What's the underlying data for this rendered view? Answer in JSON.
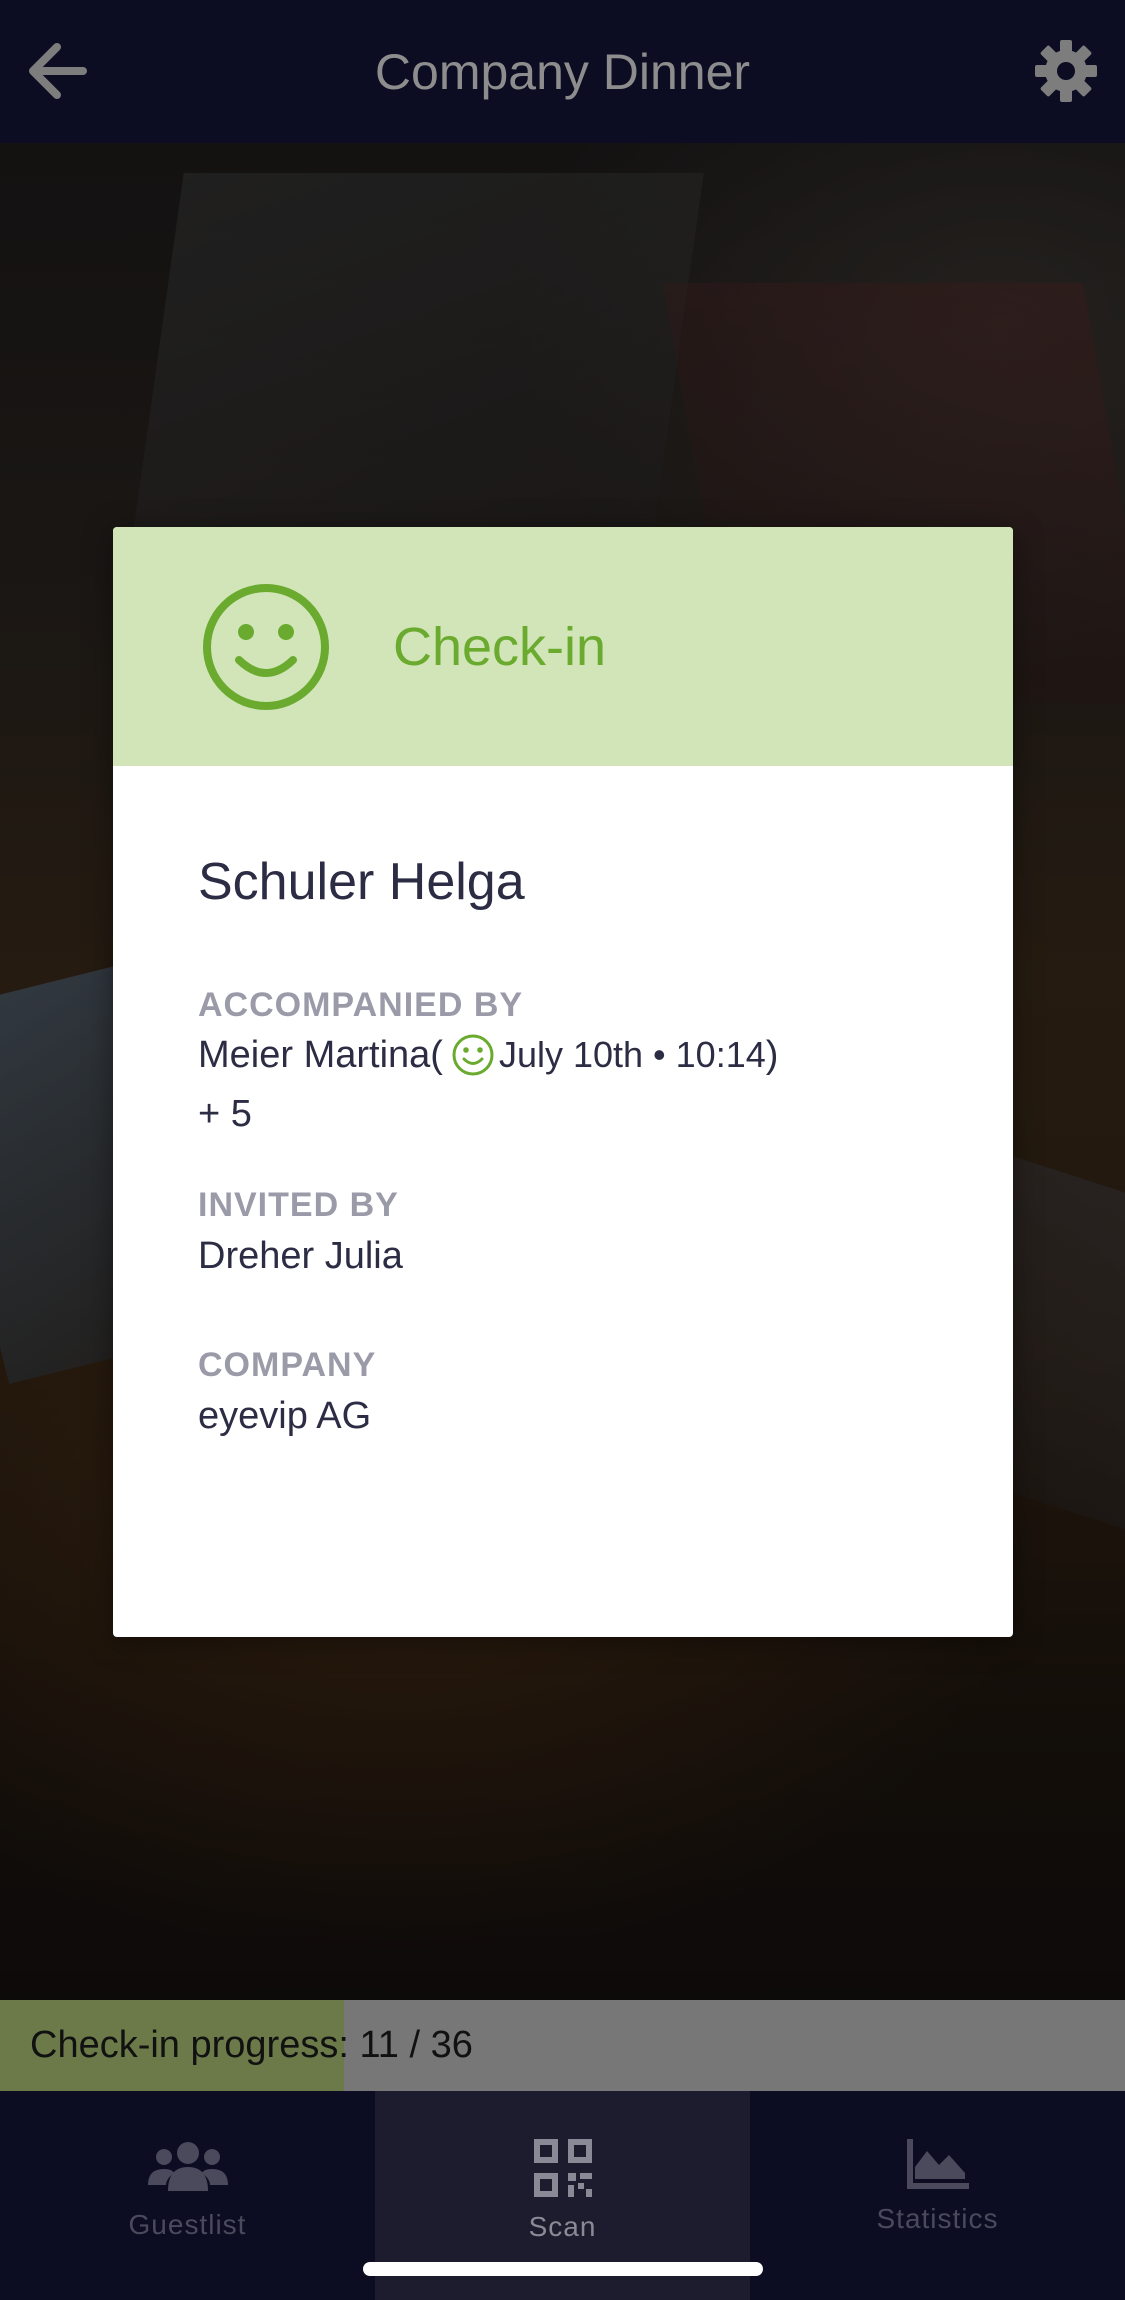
{
  "header": {
    "title": "Company Dinner",
    "back_icon": "arrow-left-icon",
    "settings_icon": "gear-icon"
  },
  "modal": {
    "status": "Check-in",
    "status_icon": "smiley-icon",
    "status_color": "#6aaa2e",
    "header_bg": "#d1e5b8",
    "guest_name": "Schuler Helga",
    "accompanied_label": "ACCOMPANIED BY",
    "companion_name": "Meier Martina",
    "companion_open": "(",
    "companion_checkin_time": "July 10th • 10:14",
    "companion_close": ")",
    "additional_guests": "+ 5",
    "invited_label": "INVITED BY",
    "invited_by": "Dreher Julia",
    "company_label": "COMPANY",
    "company": "eyevip AG"
  },
  "progress": {
    "text": "Check-in progress: 11 / 36",
    "checked_in": 11,
    "total": 36,
    "fill_color": "#6b7a48"
  },
  "tabs": [
    {
      "label": "Guestlist",
      "icon": "people-icon",
      "active": false
    },
    {
      "label": "Scan",
      "icon": "qr-code-icon",
      "active": true
    },
    {
      "label": "Statistics",
      "icon": "area-chart-icon",
      "active": false
    }
  ]
}
